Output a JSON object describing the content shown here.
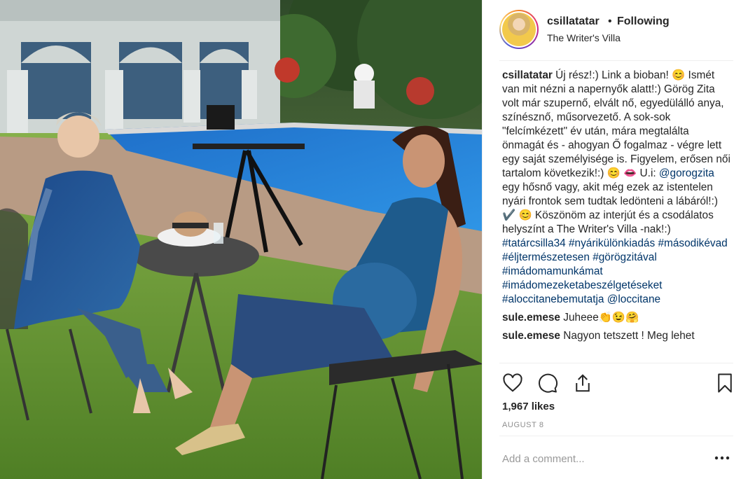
{
  "post": {
    "username": "csillatatar",
    "separator": "•",
    "follow_status": "Following",
    "location": "The Writer's Villa",
    "avatar_icon": "profile-avatar"
  },
  "caption": {
    "username": "csillatatar",
    "text_1": "Új rész!:) Link a bioban! 😊 Ismét van mit nézni a napernyők alatt!:) Görög Zita volt már szupernő, elvált nő, egyedülálló anya, színésznő, műsorvezető. A sok-sok \"felcímkézett\" év után, mára megtalálta önmagát és - ahogyan Ő fogalmaz - végre lett egy saját személyisége is. Figyelem, erősen női tartalom következik!:) 😊 👄 U.i: ",
    "mention_1": "@gorogzita",
    "text_2": " egy hősnő vagy, akit még ezek az istentelen nyári frontok sem tudtak ledönteni a lábáról!:) ✔️ 😊 Köszönöm az interjút és a csodálatos helyszínt a The Writer's Villa -nak!:) ",
    "hashtag_1": "#tatárcsilla34",
    "hashtag_2": "#nyárikülönkiadás",
    "hashtag_3": "#másodikévad",
    "hashtag_4": "#éljtermészetesen",
    "hashtag_5": "#görögzitával",
    "hashtag_6": "#imádomamunkámat",
    "hashtag_7": "#imádomezeketabeszélgetéseket",
    "hashtag_8": "#aloccitanebemutatja",
    "mention_2": "@loccitane"
  },
  "comments": [
    {
      "username": "sule.emese",
      "text": "Juheee👏😉🤗"
    },
    {
      "username": "sule.emese",
      "text": "Nagyon tetszett ! Meg lehet"
    }
  ],
  "actions": {
    "like_icon": "heart-icon",
    "comment_icon": "comment-icon",
    "share_icon": "share-icon",
    "save_icon": "bookmark-icon"
  },
  "likes_text": "1,967 likes",
  "date_text": "AUGUST 8",
  "comment_box": {
    "placeholder": "Add a comment..."
  },
  "more_icon": "more-options-icon"
}
